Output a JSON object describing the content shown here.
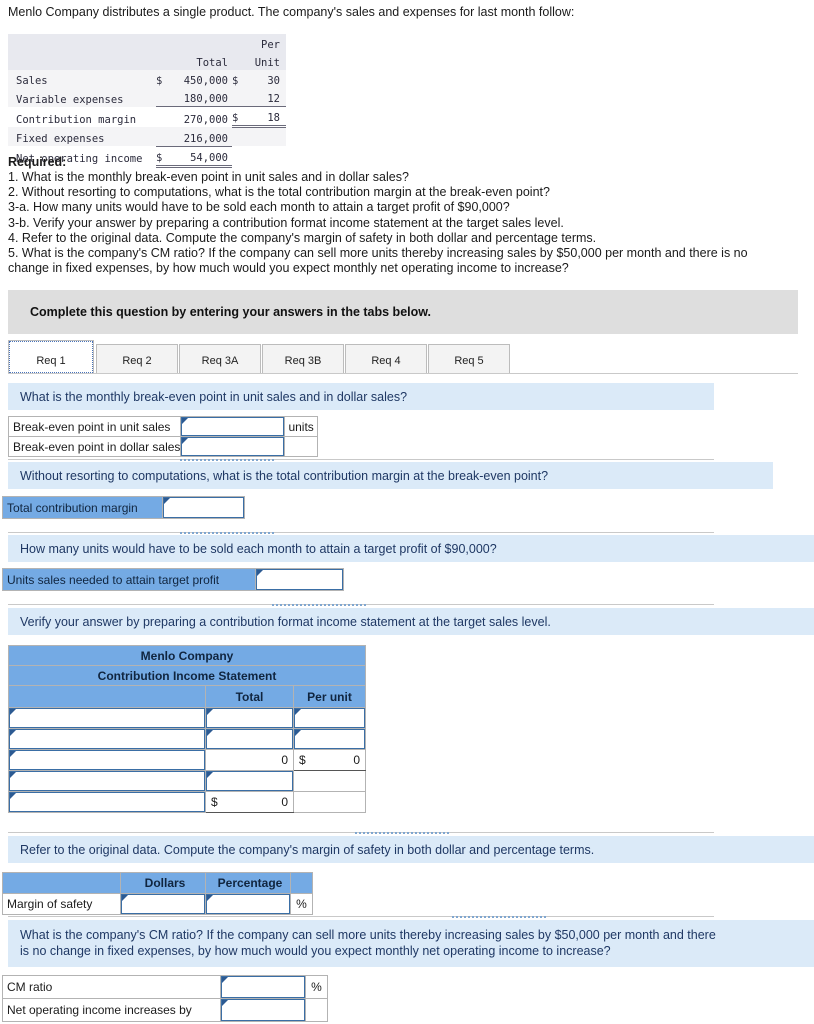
{
  "intro": "Menlo Company distributes a single product. The company's sales and expenses for last month follow:",
  "data_table": {
    "header": {
      "blank": "",
      "total": "Total",
      "per_unit_line1": "Per",
      "per_unit_line2": "Unit"
    },
    "rows": [
      {
        "label": "Sales",
        "total_sym": "$",
        "total": "450,000",
        "unit_sym": "$",
        "unit": "30"
      },
      {
        "label": "Variable expenses",
        "total_sym": "",
        "total": "180,000",
        "unit_sym": "",
        "unit": "12"
      },
      {
        "label": "Contribution margin",
        "total_sym": "",
        "total": "270,000",
        "unit_sym": "$",
        "unit": "18"
      },
      {
        "label": "Fixed expenses",
        "total_sym": "",
        "total": "216,000",
        "unit_sym": "",
        "unit": ""
      },
      {
        "label": "Net operating income",
        "total_sym": "$",
        "total": "54,000",
        "unit_sym": "",
        "unit": ""
      }
    ]
  },
  "required": {
    "title": "Required:",
    "items": [
      "1. What is the monthly break-even point in unit sales and in dollar sales?",
      "2. Without resorting to computations, what is the total contribution margin at the break-even point?",
      "3-a. How many units would have to be sold each month to attain a target profit of $90,000?",
      "3-b. Verify your answer by preparing a contribution format income statement at the target sales level.",
      "4. Refer to the original data. Compute the company's margin of safety in both dollar and percentage terms.",
      "5. What is the company's CM ratio? If the company can sell more units thereby increasing sales by $50,000 per month and there is no",
      "change in fixed expenses, by how much would you expect monthly net operating income to increase?"
    ]
  },
  "instruction_banner": "Complete this question by entering your answers in the tabs below.",
  "tabs": [
    {
      "label": "Req 1",
      "active": true
    },
    {
      "label": "Req 2",
      "active": false
    },
    {
      "label": "Req 3A",
      "active": false
    },
    {
      "label": "Req 3B",
      "active": false
    },
    {
      "label": "Req 4",
      "active": false
    },
    {
      "label": "Req 5",
      "active": false
    }
  ],
  "sections": {
    "q1": {
      "question": "What is the monthly break-even point in unit sales and in dollar sales?",
      "rows": [
        {
          "label": "Break-even point in unit sales",
          "value": "",
          "suffix": "units"
        },
        {
          "label": "Break-even point in dollar sales",
          "value": "",
          "suffix": ""
        }
      ]
    },
    "q2": {
      "question": "Without resorting to computations, what is the total contribution margin at the break-even point?",
      "row": {
        "label": "Total contribution margin",
        "value": ""
      }
    },
    "q3a": {
      "question": "How many units would have to be sold each month to attain a target profit of $90,000?",
      "row": {
        "label": "Units sales needed to attain target profit",
        "value": ""
      }
    },
    "q3b": {
      "question": "Verify your answer by preparing a contribution format income statement at the target sales level.",
      "statement": {
        "company": "Menlo Company",
        "title": "Contribution Income Statement",
        "col_blank": "",
        "col_total": "Total",
        "col_unit": "Per unit",
        "rows": [
          {
            "desc": "",
            "total_sym": "",
            "total": "",
            "total_input": true,
            "unit_sym": "",
            "unit": "",
            "unit_input": true,
            "underline": false
          },
          {
            "desc": "",
            "total_sym": "",
            "total": "",
            "total_input": true,
            "unit_sym": "",
            "unit": "",
            "unit_input": true,
            "underline": false
          },
          {
            "desc": "",
            "total_sym": "",
            "total": "0",
            "total_input": false,
            "unit_sym": "$",
            "unit": "0",
            "unit_input": false,
            "underline": true
          },
          {
            "desc": "",
            "total_sym": "",
            "total": "",
            "total_input": true,
            "unit_sym": "",
            "unit": "",
            "unit_input": false,
            "underline": false
          },
          {
            "desc": "",
            "total_sym": "$",
            "total": "0",
            "total_input": false,
            "unit_sym": "",
            "unit": "",
            "unit_input": false,
            "underline": true
          }
        ]
      }
    },
    "q4": {
      "question": "Refer to the original data. Compute the company's margin of safety in both dollar and percentage terms.",
      "col_blank": "",
      "col_dollars": "Dollars",
      "col_percentage": "Percentage",
      "row": {
        "label": "Margin of safety",
        "dollars": "",
        "percentage": "",
        "suffix": "%"
      }
    },
    "q5": {
      "question_line1": "What is the company's CM ratio? If the company can sell more units thereby increasing sales by $50,000 per month and there",
      "question_line2": "is no change in fixed expenses, by how much would you expect monthly net operating income to increase?",
      "rows": [
        {
          "label": "CM ratio",
          "value": "",
          "suffix": "%"
        },
        {
          "label": "Net operating income increases by",
          "value": "",
          "suffix": ""
        }
      ]
    }
  }
}
